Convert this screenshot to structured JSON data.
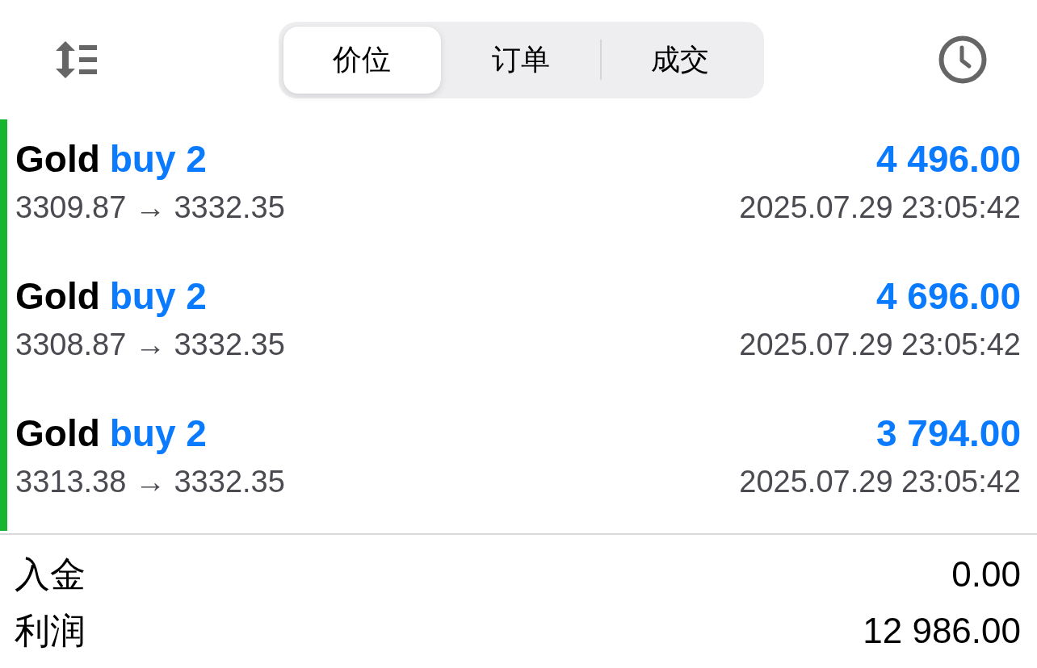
{
  "toolbar": {
    "tabs": [
      {
        "label": "价位",
        "selected": true
      },
      {
        "label": "订单",
        "selected": false
      },
      {
        "label": "成交",
        "selected": false
      }
    ]
  },
  "deals": [
    {
      "symbol": "Gold",
      "side": "buy 2",
      "profit": "4 496.00",
      "prices": "3309.87 → 3332.35",
      "time": "2025.07.29 23:05:42"
    },
    {
      "symbol": "Gold",
      "side": "buy 2",
      "profit": "4 696.00",
      "prices": "3308.87 → 3332.35",
      "time": "2025.07.29 23:05:42"
    },
    {
      "symbol": "Gold",
      "side": "buy 2",
      "profit": "3 794.00",
      "prices": "3313.38 → 3332.35",
      "time": "2025.07.29 23:05:42"
    }
  ],
  "summary": [
    {
      "label": "入金",
      "value": "0.00"
    },
    {
      "label": "利润",
      "value": "12 986.00"
    }
  ]
}
